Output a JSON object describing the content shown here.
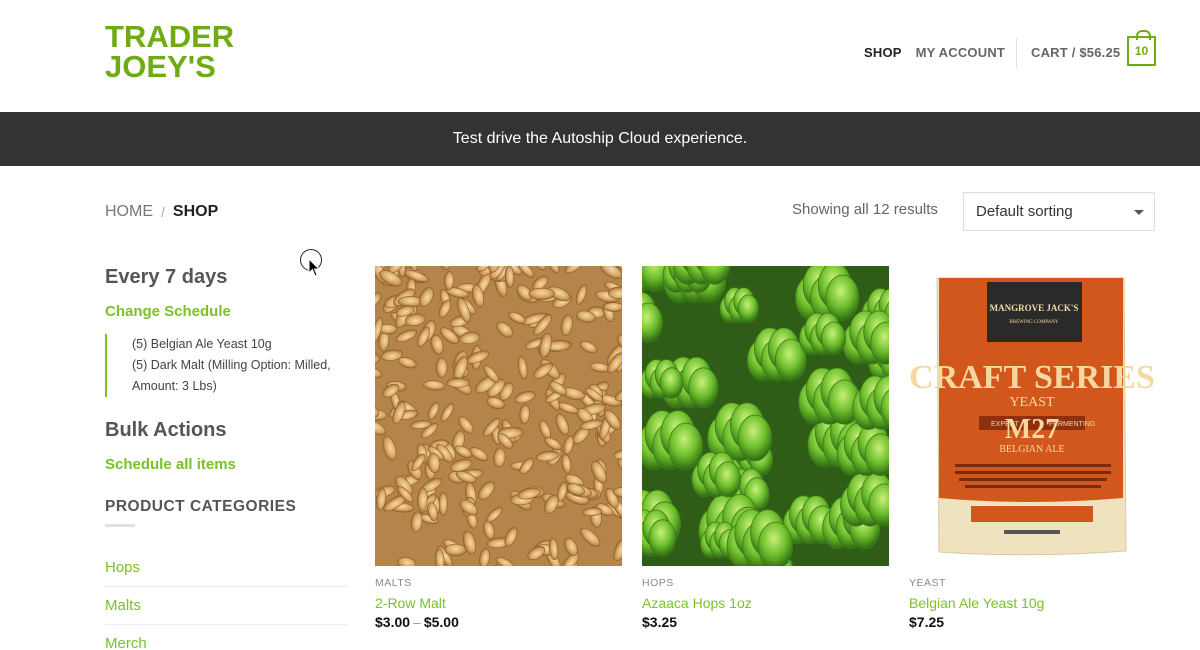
{
  "header": {
    "logo_line1": "TRADER",
    "logo_line2": "JOEY'S",
    "nav": [
      "SHOP",
      "MY ACCOUNT"
    ],
    "cart_label": "CART / $56.25",
    "cart_count": "10"
  },
  "banner": {
    "text": "Test drive the Autoship Cloud experience."
  },
  "breadcrumb": {
    "home": "HOME",
    "separator": "/",
    "current": "SHOP"
  },
  "results": {
    "count_text": "Showing all 12 results",
    "sort_value": "Default sorting"
  },
  "sidebar": {
    "schedule_heading": "Every 7 days",
    "change_link": "Change Schedule",
    "items": [
      "(5) Belgian Ale Yeast 10g",
      "(5) Dark Malt (Milling Option: Milled, Amount: 3 Lbs)"
    ],
    "bulk_heading": "Bulk Actions",
    "bulk_link": "Schedule all items",
    "categories_title": "PRODUCT CATEGORIES",
    "categories": [
      "Hops",
      "Malts",
      "Merch"
    ]
  },
  "products": [
    {
      "category": "MALTS",
      "name": "2-Row Malt",
      "price_low": "$3.00",
      "price_sep": "–",
      "price_high": "$5.00",
      "image": "malt-grains-image"
    },
    {
      "category": "HOPS",
      "name": "Azaaca Hops 1oz",
      "price": "$3.25",
      "image": "hops-image"
    },
    {
      "category": "YEAST",
      "name": "Belgian Ale Yeast 10g",
      "price": "$7.25",
      "image": "yeast-packet-image"
    }
  ],
  "yeast_packet": {
    "brand": "MANGROVE JACK'S",
    "brewing": "BREWING COMPANY",
    "series": "CRAFT SERIES",
    "yeast": "YEAST",
    "code": "M27",
    "expert": "EXPERT",
    "fermenting": "FERMENTING",
    "style": "BELGIAN ALE"
  },
  "colors": {
    "brand_green": "#6fac14",
    "link_green": "#7cc02a",
    "banner_bg": "#333333"
  }
}
